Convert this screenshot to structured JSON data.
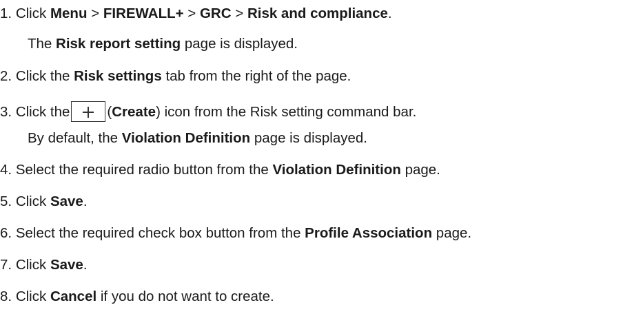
{
  "steps": [
    {
      "num": "1.",
      "click": "Click",
      "menu": "Menu",
      "gt1": ">",
      "firewall": "FIREWALL+",
      "gt2": ">",
      "grc": "GRC",
      "gt3": ">",
      "rc": "Risk and compliance",
      "end": ".",
      "sub_the": "The",
      "sub_page": "Risk report setting",
      "sub_end": "page is displayed."
    },
    {
      "num": "2.",
      "click": "Click the",
      "tab": "Risk settings",
      "end": "tab from the right of the page."
    },
    {
      "num": "3.",
      "click": "Click the",
      "paren_open": "(",
      "create": "Create",
      "paren_close": ")",
      "end": "icon from the Risk setting command bar.",
      "sub_default": "By default, the",
      "sub_page": "Violation Definition",
      "sub_end": "page is displayed."
    },
    {
      "num": "4.",
      "text": "Select the required radio button from the",
      "page": "Violation Definition",
      "end": "page."
    },
    {
      "num": "5.",
      "click": "Click",
      "save": "Save",
      "end": "."
    },
    {
      "num": "6.",
      "text": "Select the required check box button from the",
      "page": "Profile Association",
      "end": "page."
    },
    {
      "num": "7.",
      "click": "Click",
      "save": "Save",
      "end": "."
    },
    {
      "num": "8.",
      "click": "Click",
      "cancel": "Cancel",
      "end": "if you do not want to create."
    }
  ],
  "icons": {
    "create": "plus-icon"
  }
}
